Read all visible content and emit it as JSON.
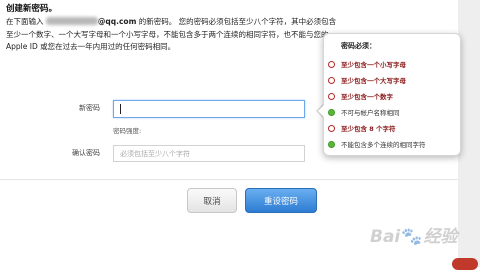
{
  "header": {
    "title": "创建新密码。",
    "desc_before": "在下面输入",
    "email_suffix": "@qq.com",
    "desc_after": "的新密码。 您的密码必须包括至少八个字符，其中必须包含至少一个数字、一个大写字母和一个小写字母，不能包含多于两个连续的相同字符，也不能与您的 Apple ID 或您在过去一年内用过的任何密码相同。"
  },
  "form": {
    "new_password_label": "新密码",
    "new_password_value": "",
    "strength_label": "密码强度:",
    "confirm_label": "确认密码",
    "confirm_placeholder": "必须包括至少八个字符",
    "confirm_value": ""
  },
  "buttons": {
    "cancel_label": "取消",
    "reset_label": "重设密码"
  },
  "requirements": {
    "title": "密码必须：",
    "met_color": "#59b83a",
    "unmet_color": "#b22a2a",
    "items": [
      {
        "text": "至少包含一个小写字母",
        "met": false
      },
      {
        "text": "至少包含一个大写字母",
        "met": false
      },
      {
        "text": "至少包含一个数字",
        "met": false
      },
      {
        "text": "不可与帐户名称相同",
        "met": true
      },
      {
        "text": "至少包含 8 个字符",
        "met": false
      },
      {
        "text": "不能包含多个连续的相同字符",
        "met": true
      }
    ]
  },
  "watermark": {
    "text_left": "Bai",
    "paw_icon": "paw-icon",
    "text_right": "经验"
  },
  "accent_color": "#3a86d9"
}
